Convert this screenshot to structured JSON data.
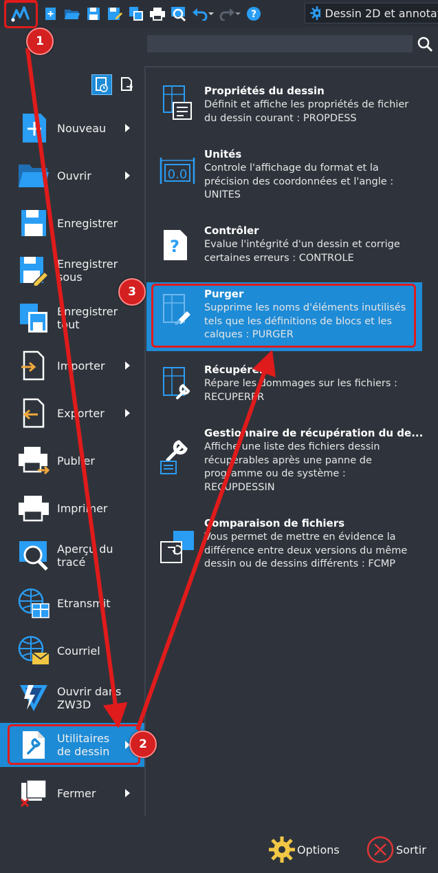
{
  "toolbar": {
    "workspace_label": "Dessin 2D et annotat",
    "icons": [
      "app-icon",
      "new-icon",
      "open-icon",
      "save-icon",
      "save-as-icon",
      "save-all-icon",
      "print-icon",
      "preview-icon",
      "undo-icon",
      "redo-icon",
      "help-icon",
      "gear-icon"
    ]
  },
  "menu": {
    "items": [
      {
        "label": "Nouveau",
        "arrow": true
      },
      {
        "label": "Ouvrir",
        "arrow": true
      },
      {
        "label": "Enregistrer",
        "arrow": false
      },
      {
        "label": "Enregistrer\nsous",
        "arrow": false
      },
      {
        "label": "Enregistrer\ntout",
        "arrow": false
      },
      {
        "label": "Importer",
        "arrow": true
      },
      {
        "label": "Exporter",
        "arrow": true
      },
      {
        "label": "Publier",
        "arrow": false
      },
      {
        "label": "Imprimer",
        "arrow": false
      },
      {
        "label": "Aperçu du\ntracé",
        "arrow": false
      },
      {
        "label": "Etransmit",
        "arrow": false
      },
      {
        "label": "Courriel",
        "arrow": false
      },
      {
        "label": "Ouvrir dans\nZW3D",
        "arrow": false
      },
      {
        "label": "Utilitaires\nde dessin",
        "arrow": true
      },
      {
        "label": "Fermer",
        "arrow": true
      }
    ]
  },
  "panel": {
    "items": [
      {
        "title": "Propriétés du dessin",
        "desc": "Définit et affiche les propriétés de fichier du dessin courant :  PROPDESS"
      },
      {
        "title": "Unités",
        "desc": "Controle l'affichage du format et la précision des coordonnées et l'angle :  UNITES"
      },
      {
        "title": "Contrôler",
        "desc": "Evalue l'intégrité d'un dessin et corrige certaines erreurs :  CONTROLE"
      },
      {
        "title": "Purger",
        "desc": "Supprime les noms d'éléments inutilisés tels que les définitions de blocs et les calques :  PURGER"
      },
      {
        "title": "Récupérer",
        "desc": "Répare les dommages sur les fichiers :  RECUPERER"
      },
      {
        "title": "Gestionnaire de récupération du de...",
        "desc": "Affiche une liste des fichiers dessin récupérables après une panne de programme ou de système :  RECUPDESSIN"
      },
      {
        "title": "Comparaison de fichiers",
        "desc": "Vous permet de mettre en évidence la différence entre deux versions du même dessin ou de dessins différents : FCMP"
      }
    ]
  },
  "bottom": {
    "options_label": "Options",
    "exit_label": "Sortir"
  },
  "annotations": {
    "badge1": "1",
    "badge2": "2",
    "badge3": "3"
  },
  "colors": {
    "accent": "#1e8bd6",
    "annotation_red": "#e01b1b",
    "background": "#2f343c"
  }
}
